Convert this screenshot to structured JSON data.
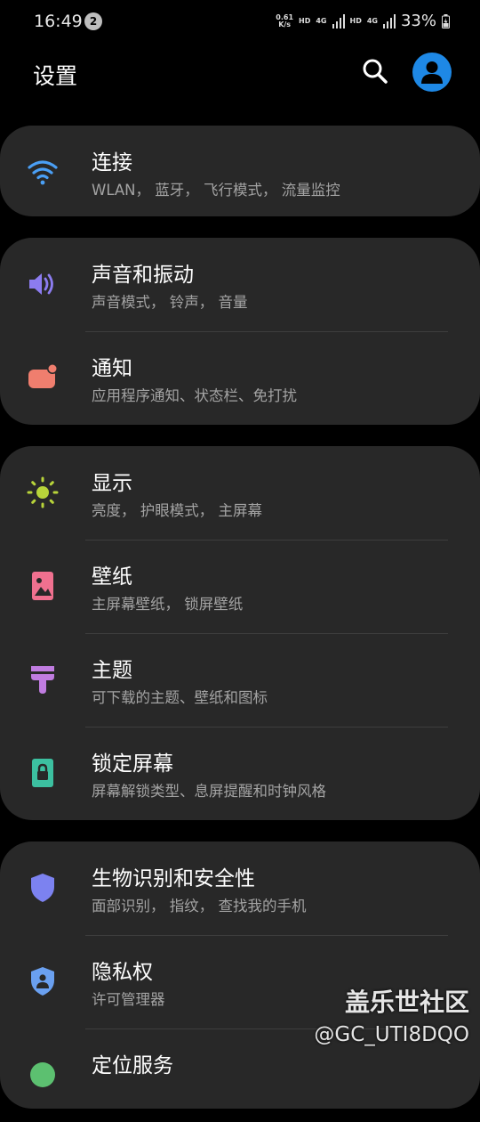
{
  "status_bar": {
    "time": "16:49",
    "notification_count": "2",
    "net_speed_value": "0.61",
    "net_speed_unit": "K/s",
    "hd1": "HD",
    "sim1": "4G",
    "hd2": "HD",
    "sim2": "4G",
    "battery": "33%"
  },
  "header": {
    "title": "设置"
  },
  "groups": [
    {
      "items": [
        {
          "label": "连接",
          "subtitle": "WLAN， 蓝牙， 飞行模式， 流量监控",
          "icon": "wifi-icon",
          "color": "#4a9ff5"
        }
      ]
    },
    {
      "items": [
        {
          "label": "声音和振动",
          "subtitle": "声音模式， 铃声， 音量",
          "icon": "volume-icon",
          "color": "#8c7cf0"
        },
        {
          "label": "通知",
          "subtitle": "应用程序通知、状态栏、免打扰",
          "icon": "notification-icon",
          "color": "#f07e6e"
        }
      ]
    },
    {
      "items": [
        {
          "label": "显示",
          "subtitle": "亮度， 护眼模式， 主屏幕",
          "icon": "brightness-icon",
          "color": "#b8d43a"
        },
        {
          "label": "壁纸",
          "subtitle": "主屏幕壁纸， 锁屏壁纸",
          "icon": "wallpaper-icon",
          "color": "#f0708f"
        },
        {
          "label": "主题",
          "subtitle": "可下载的主题、壁纸和图标",
          "icon": "theme-brush-icon",
          "color": "#c07ce0"
        },
        {
          "label": "锁定屏幕",
          "subtitle": "屏幕解锁类型、息屏提醒和时钟风格",
          "icon": "lock-screen-icon",
          "color": "#3cc0a0"
        }
      ]
    },
    {
      "items": [
        {
          "label": "生物识别和安全性",
          "subtitle": "面部识别， 指纹， 查找我的手机",
          "icon": "shield-icon",
          "color": "#7c82f0"
        },
        {
          "label": "隐私权",
          "subtitle": "许可管理器",
          "icon": "privacy-shield-icon",
          "color": "#6aa0f0"
        },
        {
          "label": "定位服务",
          "subtitle": "",
          "icon": "location-icon",
          "color": "#5cc070"
        }
      ]
    }
  ],
  "watermark": {
    "line1": "盖乐世社区",
    "line2": "@GC_UTI8DQO"
  }
}
